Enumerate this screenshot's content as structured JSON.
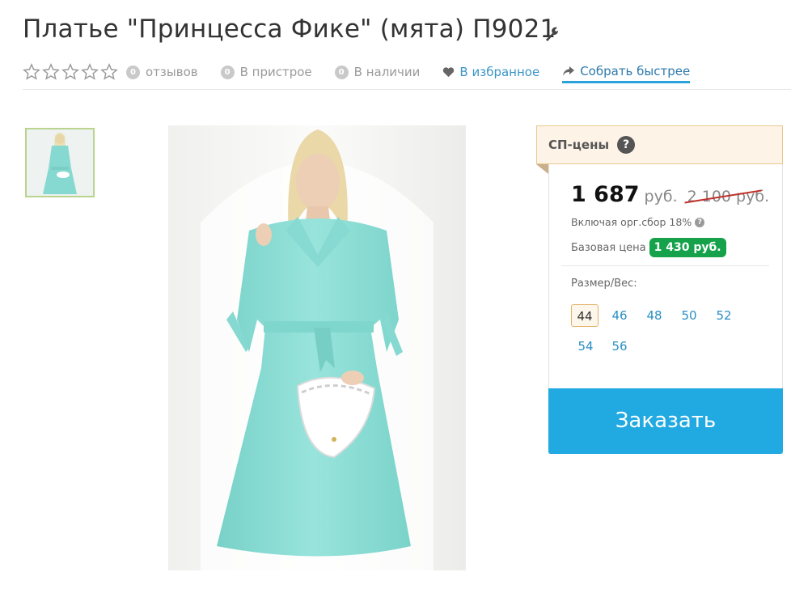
{
  "product": {
    "title": "Платье \"Принцесса Фике\" (мята) П9021"
  },
  "meta": {
    "rating_stars": 5,
    "reviews_count": "0",
    "reviews_label": "отзывов",
    "attach_count": "0",
    "attach_label": "В пристрое",
    "stock_count": "0",
    "stock_label": "В наличии",
    "favorite_label": "В избранное",
    "collect_label": "Собрать быстрее"
  },
  "pricing": {
    "sp_label": "СП-цены",
    "sp_help": "?",
    "price": "1 687",
    "currency": "руб.",
    "old_price": "2 100 руб.",
    "fee_note": "Включая орг.сбор 18%",
    "fee_help": "?",
    "base_label": "Базовая цена",
    "base_price": "1 430 руб."
  },
  "sizes": {
    "label": "Размер/Вес:",
    "options": [
      "44",
      "46",
      "48",
      "50",
      "52",
      "54",
      "56"
    ],
    "selected": "44"
  },
  "order_button": "Заказать",
  "colors": {
    "accent": "#21a9e1",
    "link": "#2a8fc4",
    "green_badge": "#15a24a",
    "dress": "#8fe0d8"
  }
}
